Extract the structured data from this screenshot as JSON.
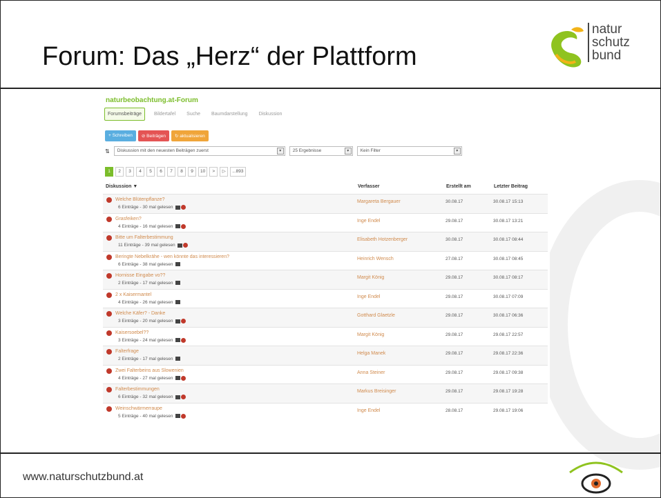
{
  "slide": {
    "title": "Forum: Das „Herz“ der Plattform",
    "footer_url": "www.naturschutzbund.at",
    "logo_lines": [
      "natur",
      "schutz",
      "bund"
    ]
  },
  "forum": {
    "heading": "naturbeobachtung.at-Forum",
    "tabs": [
      {
        "label": "Forumsbeiträge",
        "active": true
      },
      {
        "label": "Bildertafel"
      },
      {
        "label": "Suche"
      },
      {
        "label": "Baumdarstellung"
      },
      {
        "label": "Diskussion"
      }
    ],
    "toolbar": {
      "write": "+ Schreiben",
      "delete": "⊘ Beiträgen",
      "refresh": "↻ aktualisieren"
    },
    "filters": {
      "sort": "Diskussion mit den neuesten Beiträgen zuerst",
      "results": "25 Ergebnisse",
      "filter": "Kein Filter"
    },
    "pager": [
      "1",
      "2",
      "3",
      "4",
      "5",
      "6",
      "7",
      "8",
      "9",
      "10",
      ">",
      "▷",
      "...893"
    ],
    "columns": {
      "discussion": "Diskussion",
      "author": "Verfasser",
      "created": "Erstellt am",
      "last": "Letzter Beitrag"
    },
    "rows": [
      {
        "title": "Welche Blütenpflanze?",
        "meta": "6 Einträge - 30 mal gelesen",
        "author": "Margareta Bergauer",
        "created": "30.08.17",
        "last": "30.08.17 15:13",
        "icons": 2
      },
      {
        "title": "Grasfeiken?",
        "meta": "4 Einträge - 16 mal gelesen",
        "author": "Inge Endel",
        "created": "29.08.17",
        "last": "30.08.17 13:21",
        "icons": 2
      },
      {
        "title": "Bitte um Falterbestimmung",
        "meta": "11 Einträge - 39 mal gelesen",
        "author": "Elisabeth Hotzenberger",
        "created": "30.08.17",
        "last": "30.08.17 08:44",
        "icons": 2
      },
      {
        "title": "Beringte Nebelkrähe - wen könnte das interessieren?",
        "meta": "6 Einträge - 38 mal gelesen",
        "author": "Heinrich Wensch",
        "created": "27.08.17",
        "last": "30.08.17 08:45",
        "icons": 1
      },
      {
        "title": "Hornisse Eingabe vo??",
        "meta": "2 Einträge - 17 mal gelesen",
        "author": "Margit König",
        "created": "29.08.17",
        "last": "30.08.17 08:17",
        "icons": 1
      },
      {
        "title": "2 x Kaisermantel",
        "meta": "4 Einträge - 26 mal gelesen",
        "author": "Inge Endel",
        "created": "29.08.17",
        "last": "30.08.17 07:09",
        "icons": 1
      },
      {
        "title": "Welche Käfer? - Danke",
        "meta": "3 Einträge - 20 mal gelesen",
        "author": "Gotthard Glaetzle",
        "created": "29.08.17",
        "last": "30.08.17 06:36",
        "icons": 2
      },
      {
        "title": "Kaisersoebel??",
        "meta": "3 Einträge - 24 mal gelesen",
        "author": "Margit König",
        "created": "29.08.17",
        "last": "29.08.17 22:57",
        "icons": 2
      },
      {
        "title": "Falterfrage",
        "meta": "2 Einträge - 17 mal gelesen",
        "author": "Helga Manek",
        "created": "29.08.17",
        "last": "29.08.17 22:36",
        "icons": 1
      },
      {
        "title": "Zwei Falterbeins aus Slowenien",
        "meta": "4 Einträge - 27 mal gelesen",
        "author": "Anna Steiner",
        "created": "29.08.17",
        "last": "29.08.17 09:38",
        "icons": 2
      },
      {
        "title": "Falterbestimmungen",
        "meta": "6 Einträge - 32 mal gelesen",
        "author": "Markus Breisinger",
        "created": "29.08.17",
        "last": "29.08.17 19:28",
        "icons": 2
      },
      {
        "title": "Weinschwärmerraupe",
        "meta": "5 Einträge - 40 mal gelesen",
        "author": "Inge Endel",
        "created": "28.08.17",
        "last": "29.08.17 19:06",
        "icons": 2
      }
    ]
  },
  "colors": {
    "accent": "#7bbd2a",
    "link": "#d08a4c",
    "alert": "#c0392b"
  }
}
